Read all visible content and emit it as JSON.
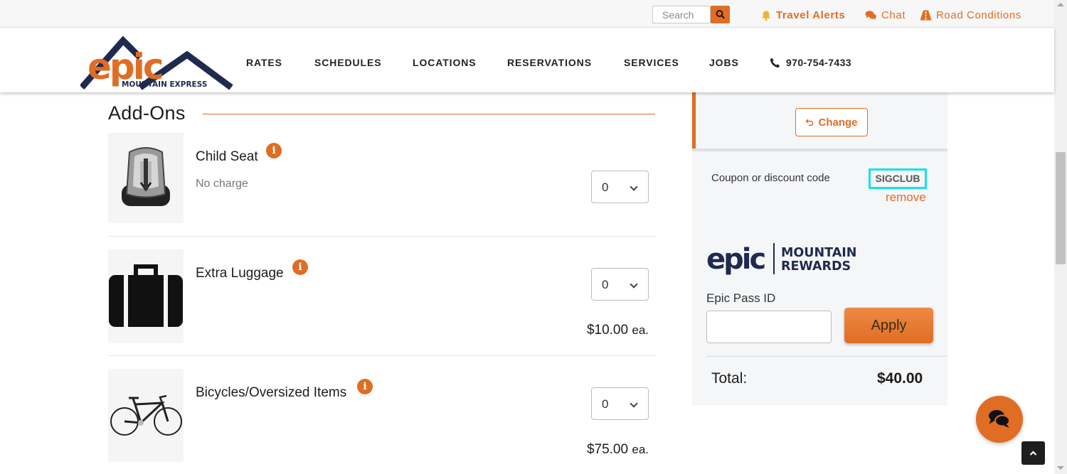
{
  "utility_bar": {
    "search_placeholder": "Search",
    "travel_alerts": "Travel Alerts",
    "chat": "Chat",
    "road_conditions": "Road Conditions"
  },
  "header": {
    "logo_brand": "epic",
    "logo_subtitle": "MOUNTAIN EXPRESS",
    "nav": [
      "RATES",
      "SCHEDULES",
      "LOCATIONS",
      "RESERVATIONS",
      "SERVICES",
      "JOBS"
    ],
    "phone": "970-754-7433"
  },
  "addons": {
    "title": "Add-Ons",
    "items": [
      {
        "name": "Child Seat",
        "subtitle": "No charge",
        "qty": "0",
        "price": "",
        "price_suffix": ""
      },
      {
        "name": "Extra Luggage",
        "subtitle": "",
        "qty": "0",
        "price": "$10.00",
        "price_suffix": "ea."
      },
      {
        "name": "Bicycles/Oversized Items",
        "subtitle": "",
        "qty": "0",
        "price": "$75.00",
        "price_suffix": "ea."
      }
    ],
    "info_glyph": "i"
  },
  "summary": {
    "change_label": "Change",
    "coupon_label": "Coupon or discount code",
    "coupon_code": "SIGCLUB",
    "remove_label": "remove",
    "rewards_brand": "epic",
    "rewards_line1": "MOUNTAIN",
    "rewards_line2": "REWARDS",
    "pass_label": "Epic Pass ID",
    "pass_value": "",
    "apply_label": "Apply",
    "total_label": "Total:",
    "total_value": "$40.00"
  },
  "colors": {
    "accent": "#e06d24",
    "navy": "#1f2a4f",
    "highlight": "#18e1ea"
  }
}
